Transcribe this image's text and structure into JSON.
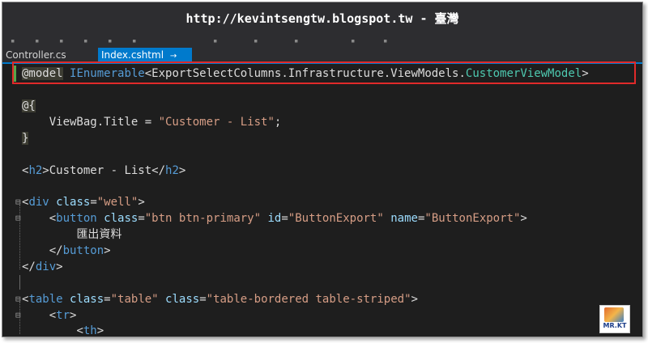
{
  "watermark": "http://kevintsengtw.blogspot.tw - 臺灣",
  "tabs": [
    {
      "label": "Controller.cs",
      "active": false
    },
    {
      "label": "Index.cshtml",
      "active": true,
      "pin": "→",
      "close": "×"
    }
  ],
  "code": {
    "l1": {
      "directive": "@model",
      "type1": "IEnumerable",
      "lt": "<",
      "ns": "ExportSelectColumns.Infrastructure.ViewModels.",
      "type2": "CustomerViewModel",
      "gt": ">"
    },
    "l2": {
      "text": "@{"
    },
    "l3": {
      "indent": "    ",
      "prop": "ViewBag.Title = ",
      "value": "\"Customer - List\"",
      "end": ";"
    },
    "l4": {
      "text": "}"
    },
    "l5": {
      "open": "<",
      "tag": "h2",
      "close": ">",
      "text": "Customer - List",
      "endopen": "</",
      "endtag": "h2",
      "endclose": ">"
    },
    "l6": {
      "open": "<",
      "tag": "div",
      "attr": " class",
      "eq": "=",
      "val": "\"well\"",
      "close": ">"
    },
    "l7": {
      "indent": "    ",
      "open": "<",
      "tag": "button",
      "a1": " class",
      "v1": "\"btn btn-primary\"",
      "a2": " id",
      "v2": "\"ButtonExport\"",
      "a3": " name",
      "v3": "\"ButtonExport\"",
      "close": ">",
      "eq": "="
    },
    "l8": {
      "indent": "        ",
      "text": "匯出資料"
    },
    "l9": {
      "indent": "    ",
      "open": "</",
      "tag": "button",
      "close": ">"
    },
    "l10": {
      "open": "</",
      "tag": "div",
      "close": ">"
    },
    "l11": {
      "open": "<",
      "tag": "table",
      "a1": " class",
      "v1": "\"table\"",
      "a2": " class",
      "v2": "\"table-bordered table-striped\"",
      "close": ">",
      "eq": "="
    },
    "l12": {
      "indent": "    ",
      "open": "<",
      "tag": "tr",
      "close": ">"
    },
    "l13": {
      "indent": "        ",
      "open": "<",
      "tag": "th",
      "close": ">"
    }
  },
  "logo": {
    "text": "MR.KT"
  },
  "icons": {
    "fold_minus": "fold-collapse-icon",
    "fold_line": "fold-guide-icon"
  },
  "colors": {
    "highlight": "#e02a2a",
    "accent": "#007acc",
    "keyword": "#569cd6",
    "type": "#4ec9b0",
    "string": "#d69d85",
    "attribute": "#9cdcfe"
  }
}
